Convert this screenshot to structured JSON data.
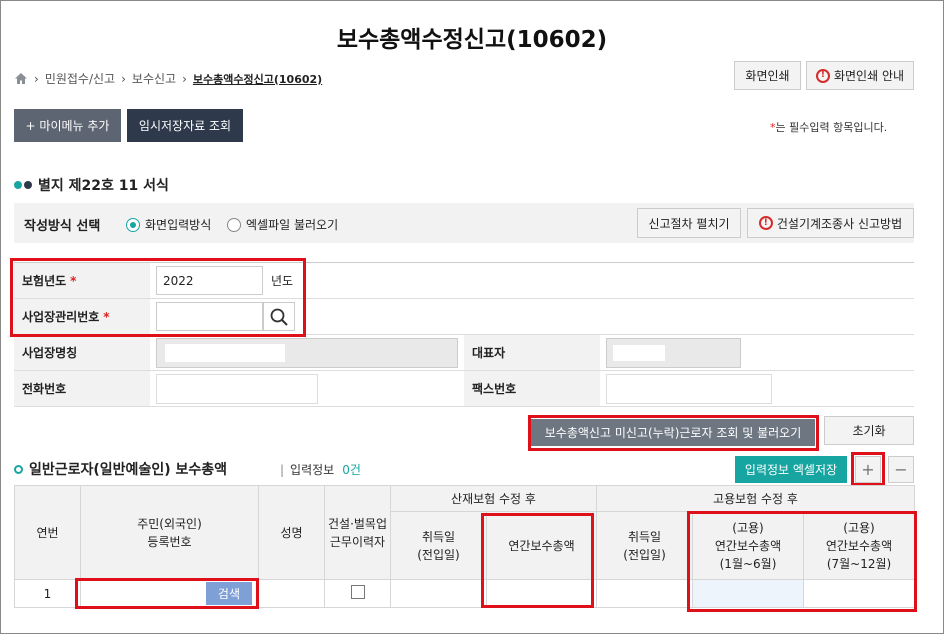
{
  "page": {
    "title": "보수총액수정신고(10602)"
  },
  "breadcrumb": {
    "items": [
      "민원접수/신고",
      "보수신고"
    ],
    "current": "보수총액수정신고(10602)"
  },
  "top_buttons": {
    "print": "화면인쇄",
    "print_guide": "화면인쇄 안내",
    "my_menu": "+ 마이메뉴 추가",
    "temp_view": "임시저장자료 조회"
  },
  "required_note": "는 필수입력 항목입니다.",
  "form_section": {
    "title": "별지 제22호 11 서식"
  },
  "method": {
    "label": "작성방식 선택",
    "options": [
      "화면입력방식",
      "엑셀파일 불러오기"
    ],
    "selected": 0,
    "procedure_btn": "신고절차 펼치기",
    "construction_btn": "건설기계조종사 신고방법"
  },
  "fields": {
    "year_label": "보험년도",
    "year_value": "2022",
    "year_unit": "년도",
    "mgmt_label": "사업장관리번호",
    "biz_name_label": "사업장명칭",
    "rep_label": "대표자",
    "phone_label": "전화번호",
    "fax_label": "팩스번호"
  },
  "actions": {
    "load_btn": "보수총액신고 미신고(누락)근로자 조회 및 불러오기",
    "reset_btn": "초기화"
  },
  "workers": {
    "title": "일반근로자(일반예술인) 보수총액",
    "info_label": "입력정보",
    "count": "0건",
    "excel_btn": "입력정보 엑셀저장",
    "plus": "+",
    "minus": "−",
    "headers": {
      "no": "연번",
      "rrn_line1": "주민(외국인)",
      "rrn_line2": "등록번호",
      "name": "성명",
      "cons_line1": "건설·벌목업",
      "cons_line2": "근무이력자",
      "sanjae": "산재보험 수정 후",
      "goyong": "고용보험 수정 후",
      "acq_line1": "취득일",
      "acq_line2": "(전입일)",
      "annual": "연간보수총액",
      "g1_line1": "(고용)",
      "g1_line2": "연간보수총액",
      "g1_line3": "(1월~6월)",
      "g2_line1": "(고용)",
      "g2_line2": "연간보수총액",
      "g2_line3": "(7월~12월)"
    },
    "rows": [
      {
        "no": "1",
        "search_btn": "검색"
      }
    ]
  }
}
